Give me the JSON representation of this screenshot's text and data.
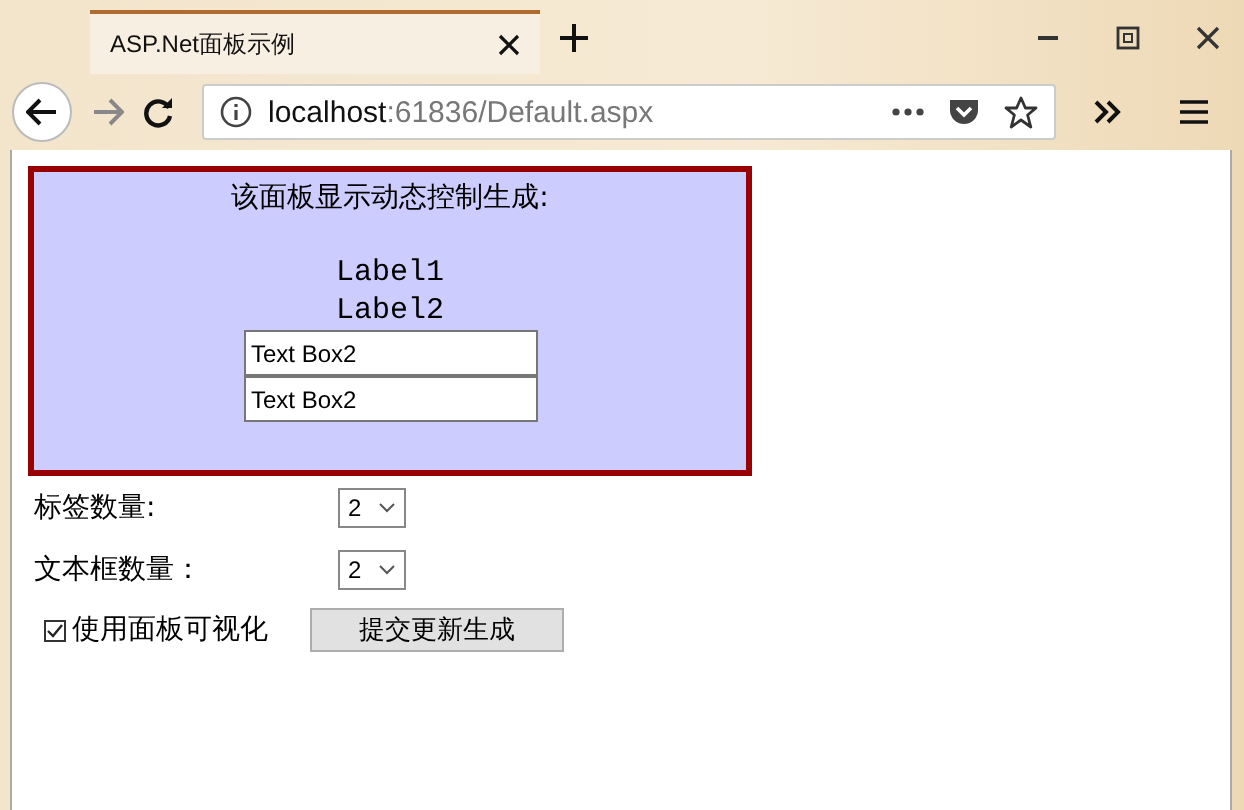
{
  "window": {
    "tab_title": "ASP.Net面板示例",
    "url_host": "localhost",
    "url_rest": ":61836/Default.aspx"
  },
  "panel": {
    "heading": "该面板显示动态控制生成:",
    "labels": [
      "Label1",
      "Label2"
    ],
    "textboxes": [
      "Text Box2",
      "Text Box2"
    ]
  },
  "form": {
    "rows": [
      {
        "label": "标签数量:",
        "value": "2"
      },
      {
        "label": "文本框数量：",
        "value": "2"
      }
    ],
    "visible": {
      "label": "使用面板可视化",
      "checked": true
    },
    "submit": "提交更新生成"
  }
}
